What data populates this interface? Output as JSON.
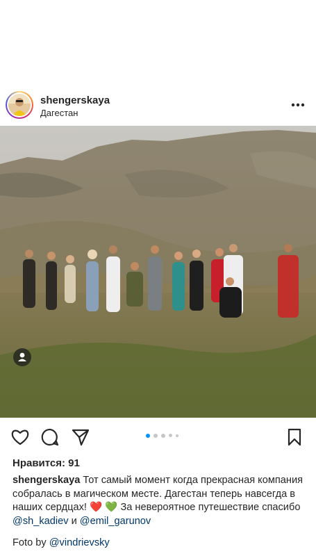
{
  "post": {
    "username": "shengerskaya",
    "location": "Дагестан",
    "likes_text": "Нравится: 91",
    "caption": {
      "username": "shengerskaya",
      "text_part1": "Тот самый момент когда прекрасная компания собралась в магическом месте. Дагестан теперь навсегда в наших сердцах! ",
      "emoji_red_heart": "❤️",
      "emoji_green_heart": "💚",
      "text_part2": " За невероятное путешествие спасибо ",
      "mention1": "@sh_kadiev",
      "text_part3": " и ",
      "mention2": "@emil_garunov"
    },
    "credit": {
      "prefix": "Foto by ",
      "mention": "@vindrievsky"
    },
    "carousel": {
      "total": 5,
      "active_index": 0
    }
  },
  "icons": {
    "more": "more-horizontal-icon",
    "like": "heart-icon",
    "comment": "comment-icon",
    "share": "share-icon",
    "save": "bookmark-icon",
    "tag": "person-tag-icon"
  },
  "colors": {
    "text": "#262626",
    "mention": "#00376b",
    "carousel_active": "#0095f6",
    "carousel_inactive": "#c7c7c7"
  }
}
